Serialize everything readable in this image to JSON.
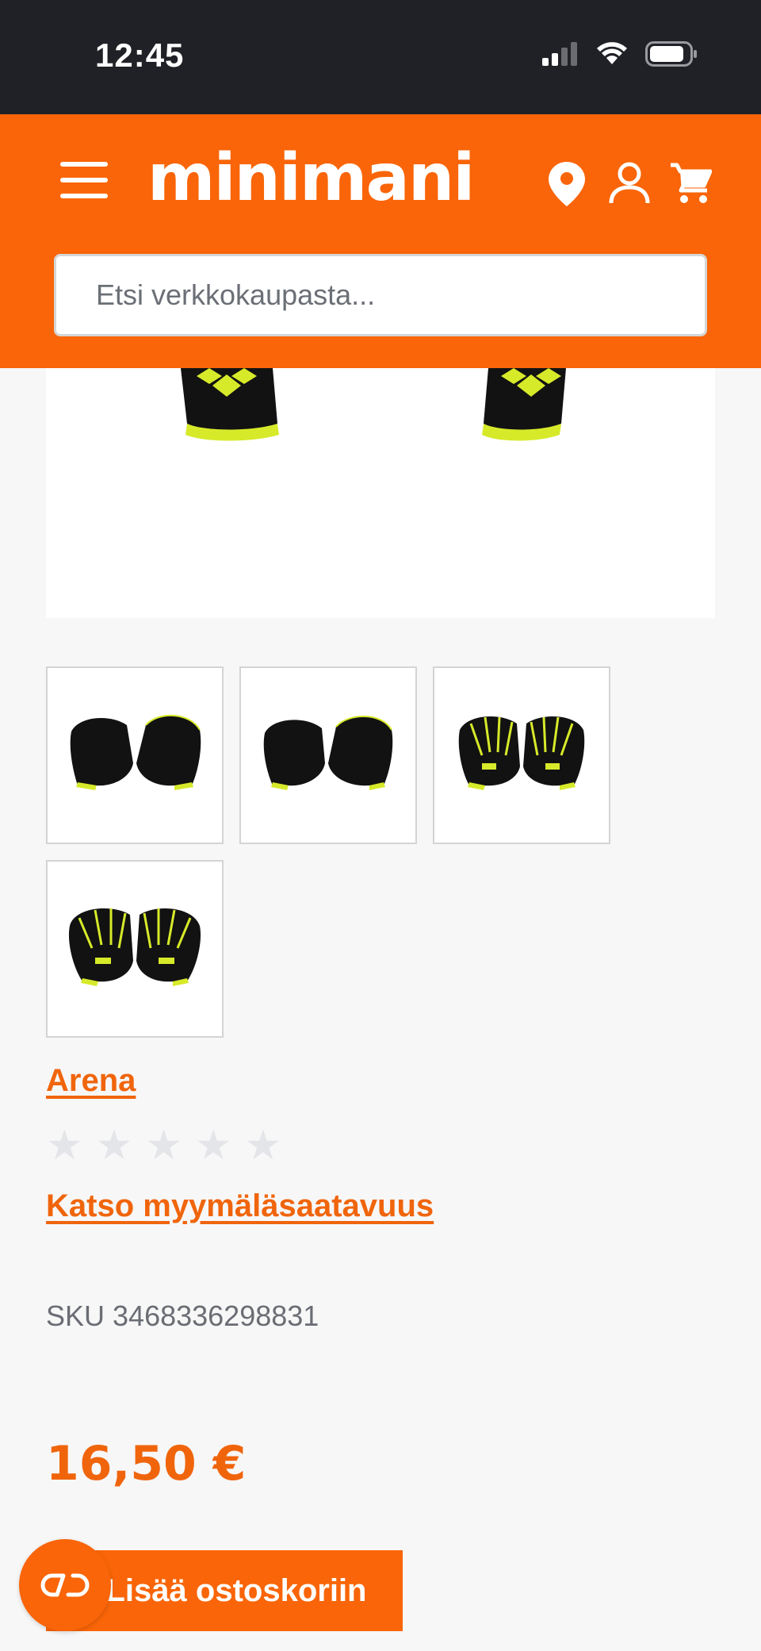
{
  "status_bar": {
    "time": "12:45"
  },
  "header": {
    "logo": "minimani",
    "search_placeholder": "Etsi verkkokaupasta..."
  },
  "product": {
    "brand": "Arena",
    "rating_stars": 5,
    "store_availability": "Katso myymäläsaatavuus",
    "sku": "SKU 3468336298831",
    "price": "16,50 €",
    "add_to_cart": "Lisää ostoskoriin",
    "thumbnails": [
      "thumb-1",
      "thumb-2",
      "thumb-3",
      "thumb-4"
    ]
  },
  "colors": {
    "brand_orange": "#f96508",
    "link_orange": "#f0650c",
    "status_bar": "#202126",
    "glove_black": "#121212",
    "glove_yellow": "#d7ea2a"
  },
  "icons": [
    "menu-icon",
    "location-icon",
    "user-icon",
    "cart-icon",
    "chat-icon",
    "signal-icon",
    "wifi-icon",
    "battery-icon"
  ]
}
